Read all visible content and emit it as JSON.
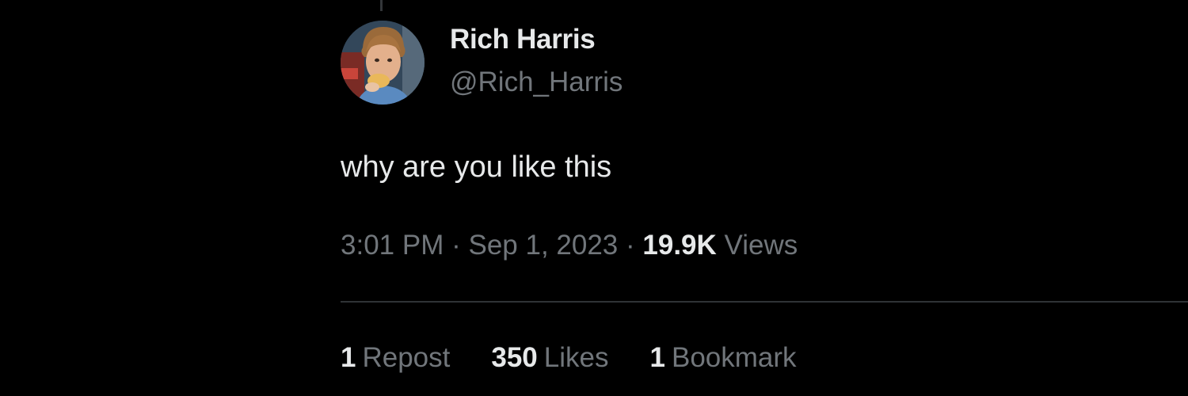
{
  "colors": {
    "background": "#000000",
    "primary_text": "#e7e9ea",
    "secondary_text": "#71767b",
    "divider": "#2f3336"
  },
  "author": {
    "display_name": "Rich Harris",
    "handle": "@Rich_Harris",
    "avatar_icon": "profile-photo"
  },
  "tweet": {
    "text": "why are you like this",
    "time": "3:01 PM",
    "date": "Sep 1, 2023",
    "separator": "·",
    "views_count": "19.9K",
    "views_label": "Views"
  },
  "stats": [
    {
      "count": "1",
      "label": "Repost"
    },
    {
      "count": "350",
      "label": "Likes"
    },
    {
      "count": "1",
      "label": "Bookmark"
    }
  ]
}
